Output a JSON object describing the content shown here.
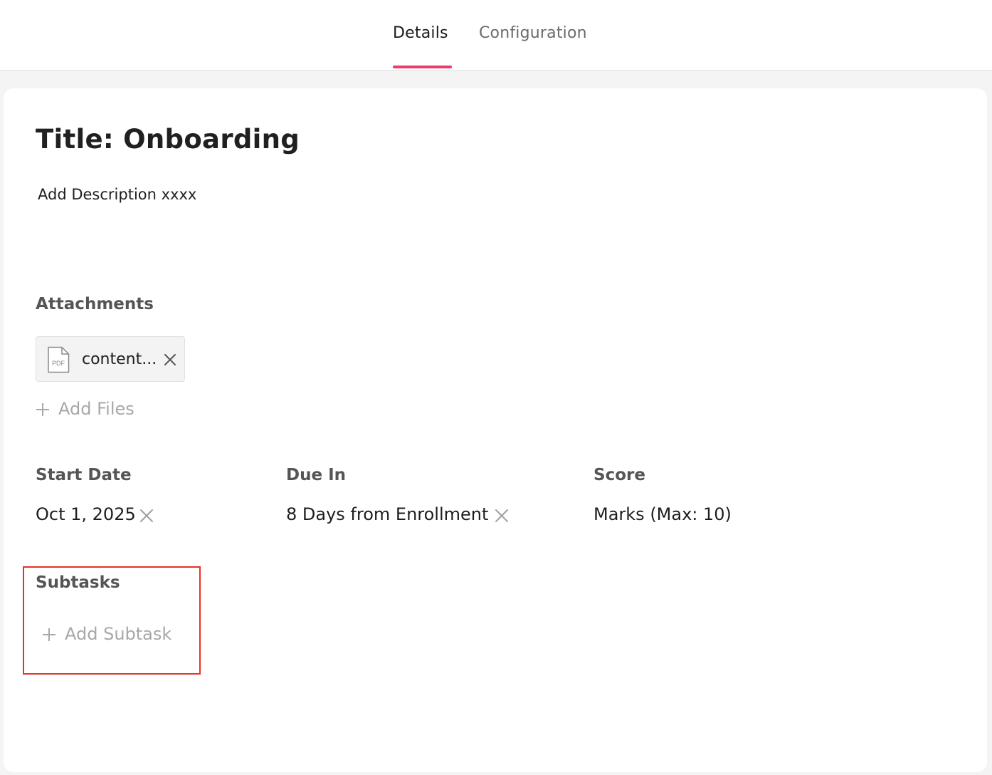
{
  "tabs": [
    {
      "label": "Details",
      "active": true
    },
    {
      "label": "Configuration",
      "active": false
    }
  ],
  "colors": {
    "accent": "#ee3b67",
    "highlight_box": "#e8331f"
  },
  "task": {
    "title": "Title: Onboarding",
    "description": "Add Description xxxx"
  },
  "attachments": {
    "label": "Attachments",
    "files": [
      {
        "icon": "pdf-file-icon",
        "icon_text": "PDF",
        "name": "content..."
      }
    ],
    "add_label": "Add Files"
  },
  "fields": {
    "start_date": {
      "label": "Start Date",
      "value": "Oct 1, 2025"
    },
    "due_in": {
      "label": "Due In",
      "value": "8 Days from Enrollment"
    },
    "score": {
      "label": "Score",
      "value": "Marks (Max: 10)"
    }
  },
  "subtasks": {
    "label": "Subtasks",
    "add_label": "Add Subtask"
  }
}
